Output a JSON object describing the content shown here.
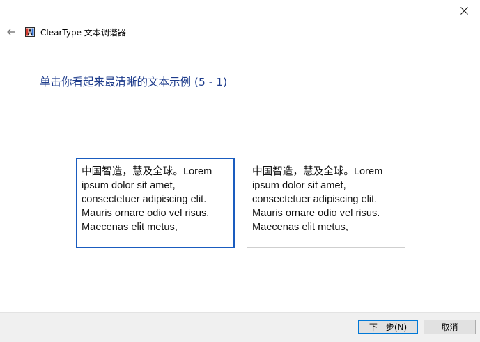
{
  "window": {
    "title": "ClearType 文本调谐器"
  },
  "heading": "单击你看起来最清晰的文本示例 (5 - 1)",
  "samples": [
    {
      "text": "中国智造，慧及全球。Lorem ipsum dolor sit amet, consectetuer adipiscing elit. Mauris ornare odio vel risus. Maecenas elit metus,",
      "selected": true
    },
    {
      "text": "中国智造，慧及全球。Lorem ipsum dolor sit amet, consectetuer adipiscing elit. Mauris ornare odio vel risus. Maecenas elit metus,",
      "selected": false
    }
  ],
  "footer": {
    "next_label": "下一步(N)",
    "cancel_label": "取消"
  },
  "icons": {
    "close": "close-icon",
    "back": "back-arrow-icon",
    "app": "cleartype-app-icon"
  },
  "colors": {
    "heading": "#1e3c8c",
    "selection_border": "#1a5cbf",
    "footer_bg": "#f0f0f0",
    "default_button_border": "#0078d7"
  }
}
